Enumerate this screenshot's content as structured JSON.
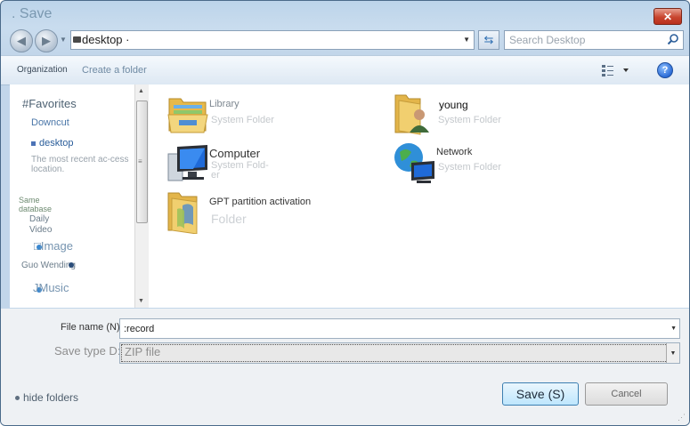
{
  "window": {
    "title": ". Save"
  },
  "navbar": {
    "address": "desktop ·",
    "search_placeholder": "Search Desktop"
  },
  "toolbar": {
    "organize": "Organization",
    "new_folder": "Create a folder"
  },
  "nav_pane": {
    "favorites_heading": "#Favorites",
    "downloads": "Downcut",
    "desktop": "desktop",
    "recent_hint": "The most recent ac-cess location.",
    "libraries_heading": "Same database",
    "libraries": [
      "Daily",
      "Video",
      "Image",
      "Guo Wending",
      "Music"
    ],
    "library_prefixes": [
      "",
      "",
      "□",
      "",
      "J"
    ]
  },
  "files": [
    {
      "name": "Library",
      "type": "System Folder",
      "icon": "library-icon"
    },
    {
      "name": "young",
      "type": "System Folder",
      "icon": "user-folder-icon"
    },
    {
      "name": "Computer",
      "type": "System Fold-er",
      "icon": "computer-icon"
    },
    {
      "name": "Network",
      "type": "System Folder",
      "icon": "network-icon"
    },
    {
      "name": "GPT partition activation",
      "type": "Folder",
      "icon": "folder-icon"
    }
  ],
  "bottom": {
    "file_name_label": "File name (N)",
    "file_name_value": ":record",
    "save_type_label": "Save type D:",
    "save_type_value": "ZIP file",
    "hide_folders": "hide folders",
    "save_button": "Save (S)",
    "cancel_button": "Cancel"
  },
  "colors": {
    "accent": "#3c7fb1",
    "close": "#c8452f",
    "link": "#4a76a8"
  }
}
